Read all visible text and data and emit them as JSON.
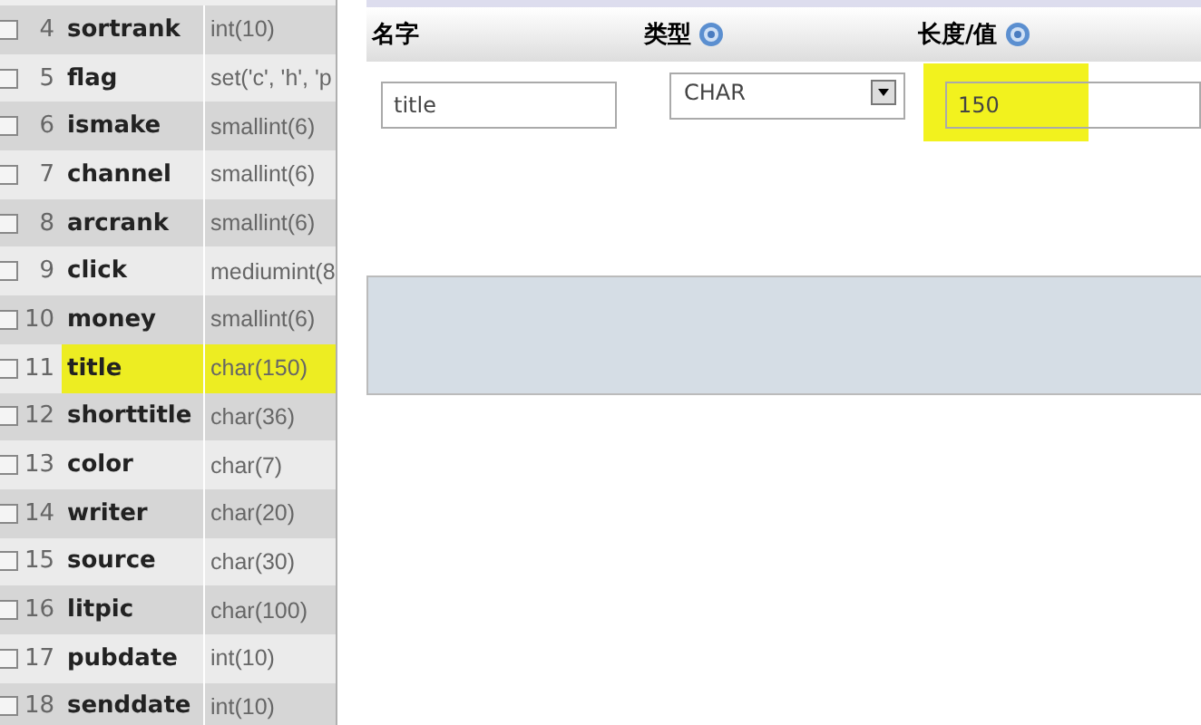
{
  "columns_table": {
    "rows": [
      {
        "number": "4",
        "name": "sortrank",
        "type": "int(10)",
        "checked": false,
        "selected": false
      },
      {
        "number": "5",
        "name": "flag",
        "type": "set('c', 'h', 'p",
        "checked": false,
        "selected": false
      },
      {
        "number": "6",
        "name": "ismake",
        "type": "smallint(6)",
        "checked": false,
        "selected": false
      },
      {
        "number": "7",
        "name": "channel",
        "type": "smallint(6)",
        "checked": false,
        "selected": false
      },
      {
        "number": "8",
        "name": "arcrank",
        "type": "smallint(6)",
        "checked": false,
        "selected": false
      },
      {
        "number": "9",
        "name": "click",
        "type": "mediumint(8",
        "checked": false,
        "selected": false
      },
      {
        "number": "10",
        "name": "money",
        "type": "smallint(6)",
        "checked": false,
        "selected": false
      },
      {
        "number": "11",
        "name": "title",
        "type": "char(150)",
        "checked": false,
        "selected": true
      },
      {
        "number": "12",
        "name": "shorttitle",
        "type": "char(36)",
        "checked": false,
        "selected": false
      },
      {
        "number": "13",
        "name": "color",
        "type": "char(7)",
        "checked": false,
        "selected": false
      },
      {
        "number": "14",
        "name": "writer",
        "type": "char(20)",
        "checked": false,
        "selected": false
      },
      {
        "number": "15",
        "name": "source",
        "type": "char(30)",
        "checked": false,
        "selected": false
      },
      {
        "number": "16",
        "name": "litpic",
        "type": "char(100)",
        "checked": false,
        "selected": false
      },
      {
        "number": "17",
        "name": "pubdate",
        "type": "int(10)",
        "checked": false,
        "selected": false
      },
      {
        "number": "18",
        "name": "senddate",
        "type": "int(10)",
        "checked": false,
        "selected": false
      }
    ]
  },
  "edit_form": {
    "headers": [
      {
        "label": "名字",
        "help": false
      },
      {
        "label": "类型",
        "help": true
      },
      {
        "label": "长度/值",
        "help": true
      }
    ],
    "name_field": {
      "value": "title"
    },
    "type_select": {
      "value": "CHAR"
    },
    "length_field": {
      "value": "150",
      "highlighted": true
    }
  }
}
